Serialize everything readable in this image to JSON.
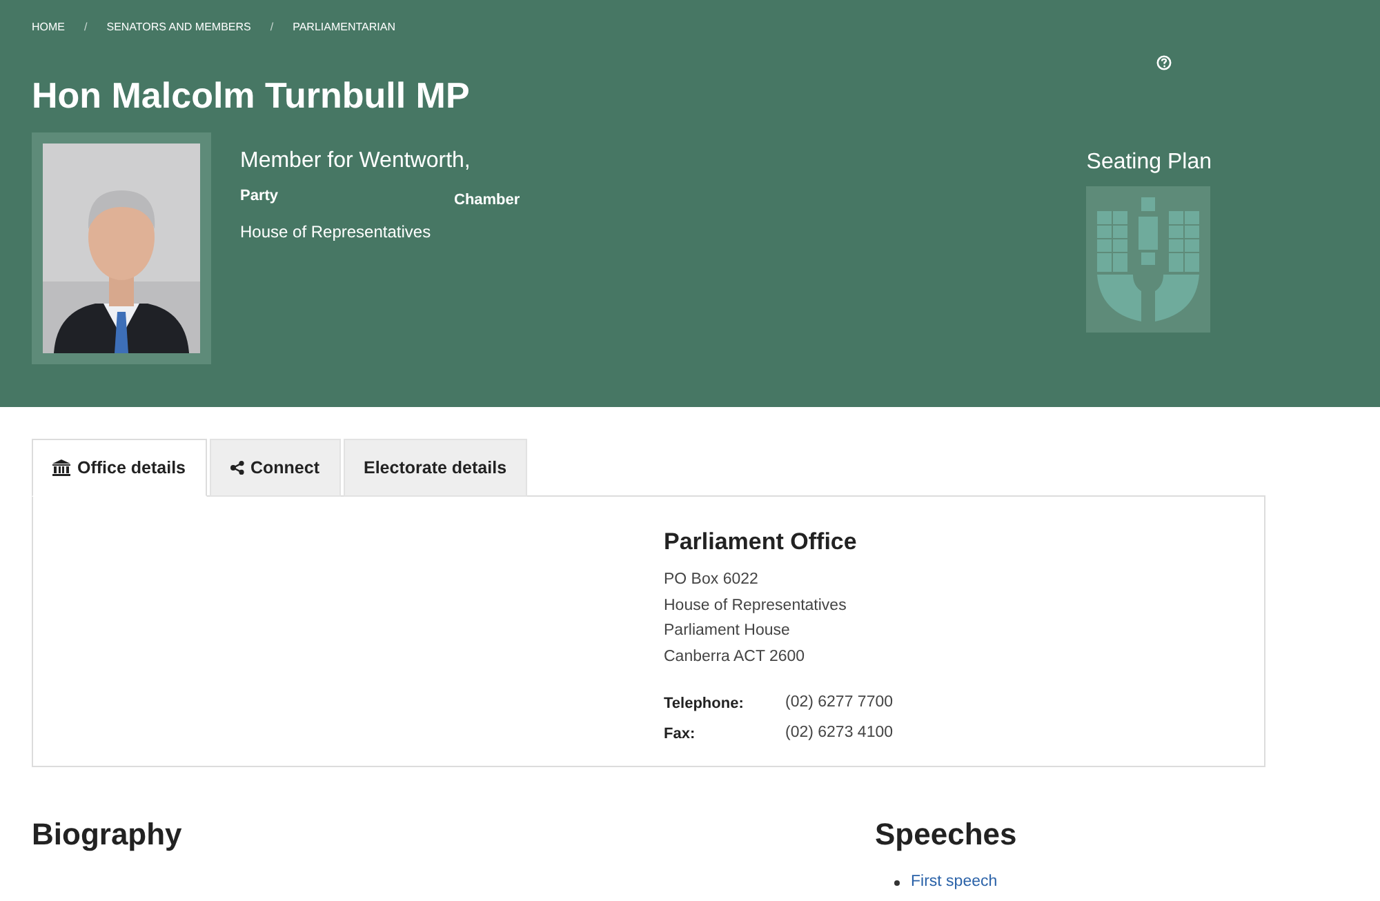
{
  "breadcrumb": [
    {
      "label": "HOME"
    },
    {
      "separator": "/",
      "label": "SENATORS AND MEMBERS"
    },
    {
      "separator": "/",
      "label": "PARLIAMENTARIAN"
    }
  ],
  "title": "Hon Malcolm Turnbull MP",
  "profile": {
    "electorate": "Member for Wentworth,",
    "party_label": "Party",
    "chamber_label": "Chamber",
    "chamber_value": "House of Representatives"
  },
  "seating_plan": {
    "title": "Seating Plan"
  },
  "tabs": [
    {
      "label": "Office details",
      "kind": "building",
      "selected": true
    },
    {
      "label": "Connect",
      "kind": "share",
      "selected": false
    },
    {
      "label": "Electorate details",
      "selected": false
    }
  ],
  "office": {
    "heading": "Parliament Office",
    "address": [
      "PO Box 6022",
      "House of Representatives",
      "Parliament House",
      "Canberra ACT 2600"
    ],
    "contacts": [
      {
        "label": "Telephone:",
        "value": "(02) 6277 7700"
      },
      {
        "label": "Fax:",
        "value": "(02) 6273 4100"
      }
    ]
  },
  "biography": {
    "heading": "Biography"
  },
  "speeches": {
    "heading": "Speeches",
    "links": [
      "First speech"
    ]
  }
}
